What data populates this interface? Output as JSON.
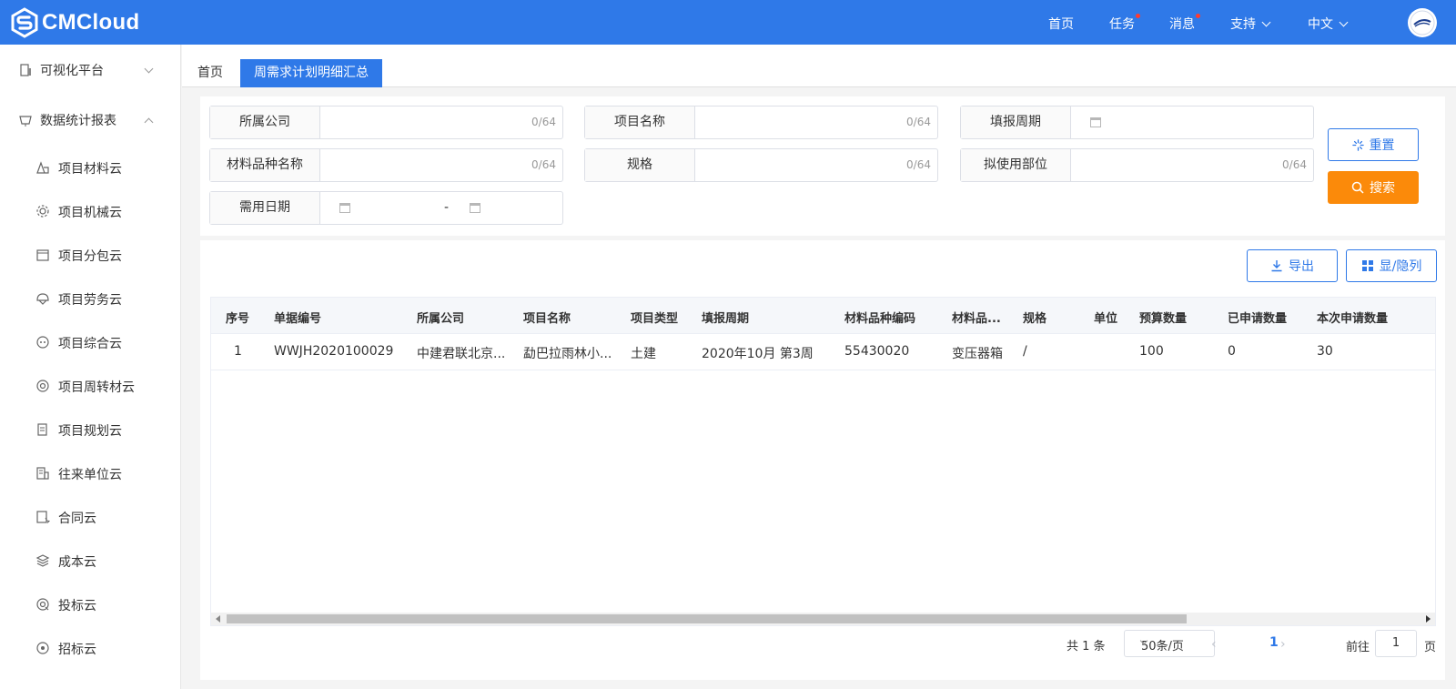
{
  "header": {
    "logo_text": "CMCloud",
    "nav": [
      {
        "label": "首页"
      },
      {
        "label": "任务",
        "has_dot": true
      },
      {
        "label": "消息",
        "has_dot": true
      },
      {
        "label": "支持",
        "has_dropdown": true
      },
      {
        "label": "中文",
        "has_dropdown": true
      }
    ],
    "brand_color": "#2f79e8"
  },
  "sidebar": {
    "groups": [
      {
        "label": "可视化平台",
        "icon": "building-icon",
        "expanded": false
      },
      {
        "label": "数据统计报表",
        "icon": "report-icon",
        "expanded": true
      }
    ],
    "items": [
      {
        "label": "项目材料云",
        "icon": "material-icon"
      },
      {
        "label": "项目机械云",
        "icon": "gear-icon"
      },
      {
        "label": "项目分包云",
        "icon": "window-icon"
      },
      {
        "label": "项目劳务云",
        "icon": "helmet-icon"
      },
      {
        "label": "项目综合云",
        "icon": "dial-icon"
      },
      {
        "label": "项目周转材云",
        "icon": "cycle-icon"
      },
      {
        "label": "项目规划云",
        "icon": "plan-icon"
      },
      {
        "label": "往来单位云",
        "icon": "office-icon"
      },
      {
        "label": "合同云",
        "icon": "contract-icon"
      },
      {
        "label": "成本云",
        "icon": "layers-icon"
      },
      {
        "label": "投标云",
        "icon": "bid-icon"
      },
      {
        "label": "招标云",
        "icon": "target-icon"
      }
    ]
  },
  "tabs": {
    "home": "首页",
    "active": "周需求计划明细汇总"
  },
  "filters": {
    "company": {
      "label": "所属公司",
      "count": "0/64"
    },
    "project_name": {
      "label": "项目名称",
      "count": "0/64"
    },
    "period": {
      "label": "填报周期"
    },
    "material_name": {
      "label": "材料品种名称",
      "count": "0/64"
    },
    "spec": {
      "label": "规格",
      "count": "0/64"
    },
    "usage_part": {
      "label": "拟使用部位",
      "count": "0/64"
    },
    "need_date": {
      "label": "需用日期",
      "separator": "-"
    },
    "reset_label": "重置",
    "search_label": "搜索"
  },
  "table": {
    "export_label": "导出",
    "columns_label": "显/隐列",
    "headers": [
      "序号",
      "单据编号",
      "所属公司",
      "项目名称",
      "项目类型",
      "填报周期",
      "材料品种编码",
      "材料品...",
      "规格",
      "单位",
      "预算数量",
      "已申请数量",
      "本次申请数量"
    ],
    "rows": [
      [
        "1",
        "WWJH2020100029",
        "中建君联北京...",
        "勐巴拉雨林小...",
        "土建",
        "2020年10月 第3周",
        "55430020",
        "变压器箱",
        "/",
        "",
        "100",
        "0",
        "30"
      ]
    ]
  },
  "pagination": {
    "total": "共 1 条",
    "page_size": "50条/页",
    "current_page": "1",
    "goto_label": "前往",
    "goto_value": "1",
    "page_suffix": "页"
  },
  "colors": {
    "accent": "#2f79e8",
    "search_button": "#fb8a0a"
  }
}
